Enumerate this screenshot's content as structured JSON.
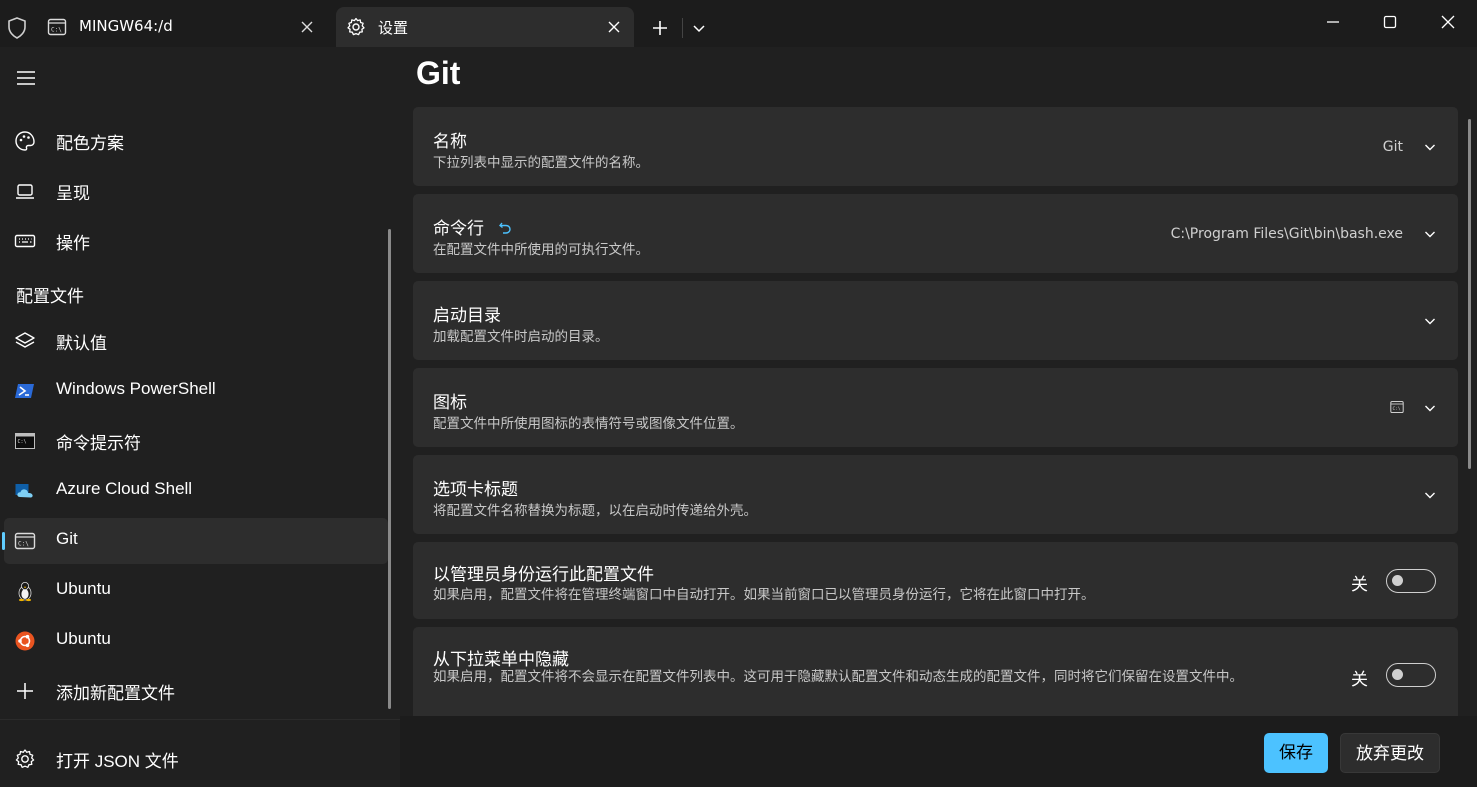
{
  "tabs": [
    {
      "label": "MINGW64:/d",
      "icon": "terminal-icon"
    },
    {
      "label": "设置",
      "icon": "gear-icon"
    }
  ],
  "sidebar": {
    "items": [
      {
        "label": "配色方案",
        "icon": "palette-icon"
      },
      {
        "label": "呈现",
        "icon": "laptop-icon"
      },
      {
        "label": "操作",
        "icon": "keyboard-icon"
      }
    ],
    "section_header": "配置文件",
    "profiles": [
      {
        "label": "默认值",
        "icon": "layers-icon"
      },
      {
        "label": "Windows PowerShell",
        "icon": "powershell-icon"
      },
      {
        "label": "命令提示符",
        "icon": "cmd-icon"
      },
      {
        "label": "Azure Cloud Shell",
        "icon": "azure-cloud-icon"
      },
      {
        "label": "Git",
        "icon": "git-terminal-icon",
        "selected": true
      },
      {
        "label": "Ubuntu",
        "icon": "linux-penguin-icon"
      },
      {
        "label": "Ubuntu",
        "icon": "ubuntu-icon"
      }
    ],
    "add_profile": "添加新配置文件",
    "open_json": "打开 JSON 文件"
  },
  "main": {
    "title": "Git",
    "settings": [
      {
        "title": "名称",
        "desc": "下拉列表中显示的配置文件的名称。",
        "value": "Git"
      },
      {
        "title": "命令行",
        "desc": "在配置文件中所使用的可执行文件。",
        "value": "C:\\Program Files\\Git\\bin\\bash.exe"
      },
      {
        "title": "启动目录",
        "desc": "加载配置文件时启动的目录。"
      },
      {
        "title": "图标",
        "desc": "配置文件中所使用图标的表情符号或图像文件位置。"
      },
      {
        "title": "选项卡标题",
        "desc": "将配置文件名称替换为标题，以在启动时传递给外壳。"
      },
      {
        "title": "以管理员身份运行此配置文件",
        "desc": "如果启用，配置文件将在管理终端窗口中自动打开。如果当前窗口已以管理员身份运行，它将在此窗口中打开。",
        "toggle": "关",
        "toggle_on": false
      },
      {
        "title": "从下拉菜单中隐藏",
        "desc": "如果启用，配置文件将不会显示在配置文件列表中。这可用于隐藏默认配置文件和动态生成的配置文件，同时将它们保留在设置文件中。",
        "toggle": "关",
        "toggle_on": false
      }
    ]
  },
  "buttons": {
    "save": "保存",
    "discard": "放弃更改"
  },
  "colors": {
    "accent": "#4cc2ff",
    "selection_indicator": "#60cdff",
    "reset_icon": "#4cc2ff"
  }
}
